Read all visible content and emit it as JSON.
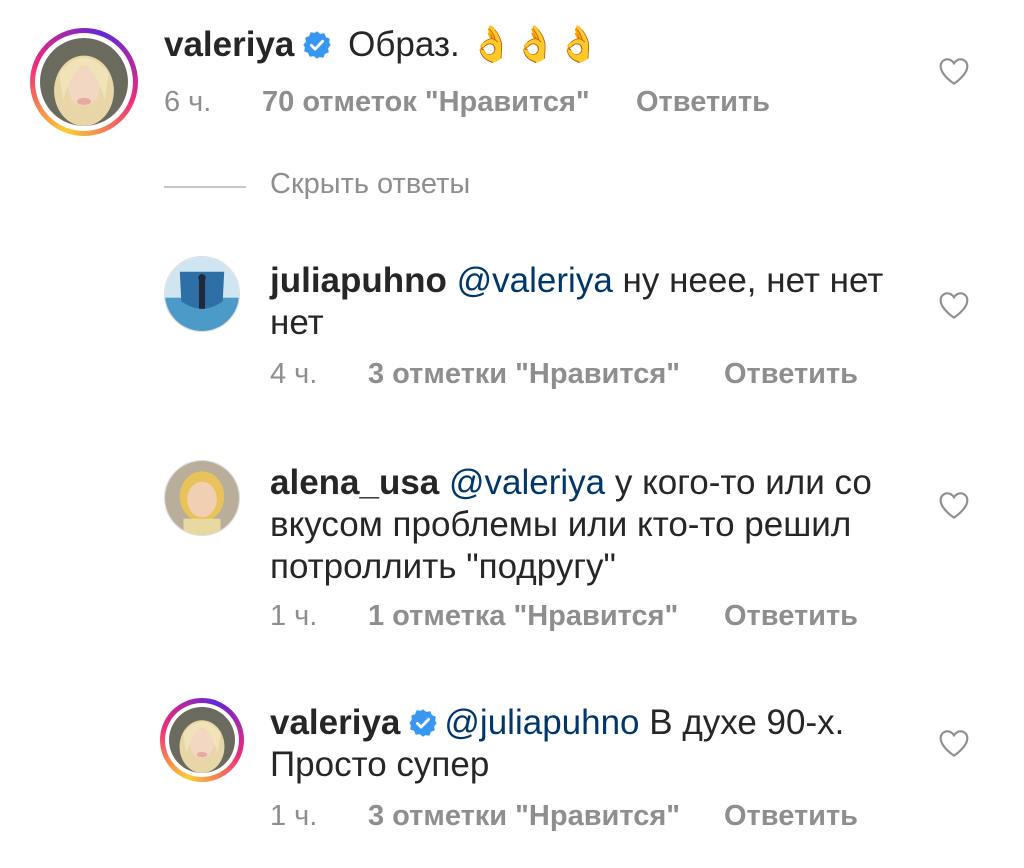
{
  "comments": [
    {
      "username": "valeriya",
      "verified": true,
      "mention": "",
      "text": " Образ. ",
      "emoji": "👌👌👌",
      "time": "6 ч.",
      "likes": "70 отметок \"Нравится\"",
      "reply": "Ответить"
    },
    {
      "username": "juliapuhno",
      "mention": "@valeriya",
      "text_line1": " ну неее, нет нет",
      "text_line2": "нет",
      "time": "4 ч.",
      "likes": "3 отметки \"Нравится\"",
      "reply": "Ответить"
    },
    {
      "username": "alena_usa",
      "mention": "@valeriya",
      "text_line1": " у кого-то или со",
      "text_line2": "вкусом проблемы или кто-то решил",
      "text_line3": "потроллить \"подругу\"",
      "time": "1 ч.",
      "likes": "1 отметка \"Нравится\"",
      "reply": "Ответить"
    },
    {
      "username": "valeriya",
      "verified": true,
      "mention": "@juliapuhno",
      "text_line1": " В духе 90-х.",
      "text_line2": "Просто супер",
      "time": "1 ч.",
      "likes": "3 отметки \"Нравится\"",
      "reply": "Ответить"
    }
  ],
  "hide_replies_label": "Скрыть ответы",
  "colors": {
    "text": "#262626",
    "secondary": "#8e8e8e",
    "mention": "#00376b",
    "verified": "#3897f0"
  }
}
